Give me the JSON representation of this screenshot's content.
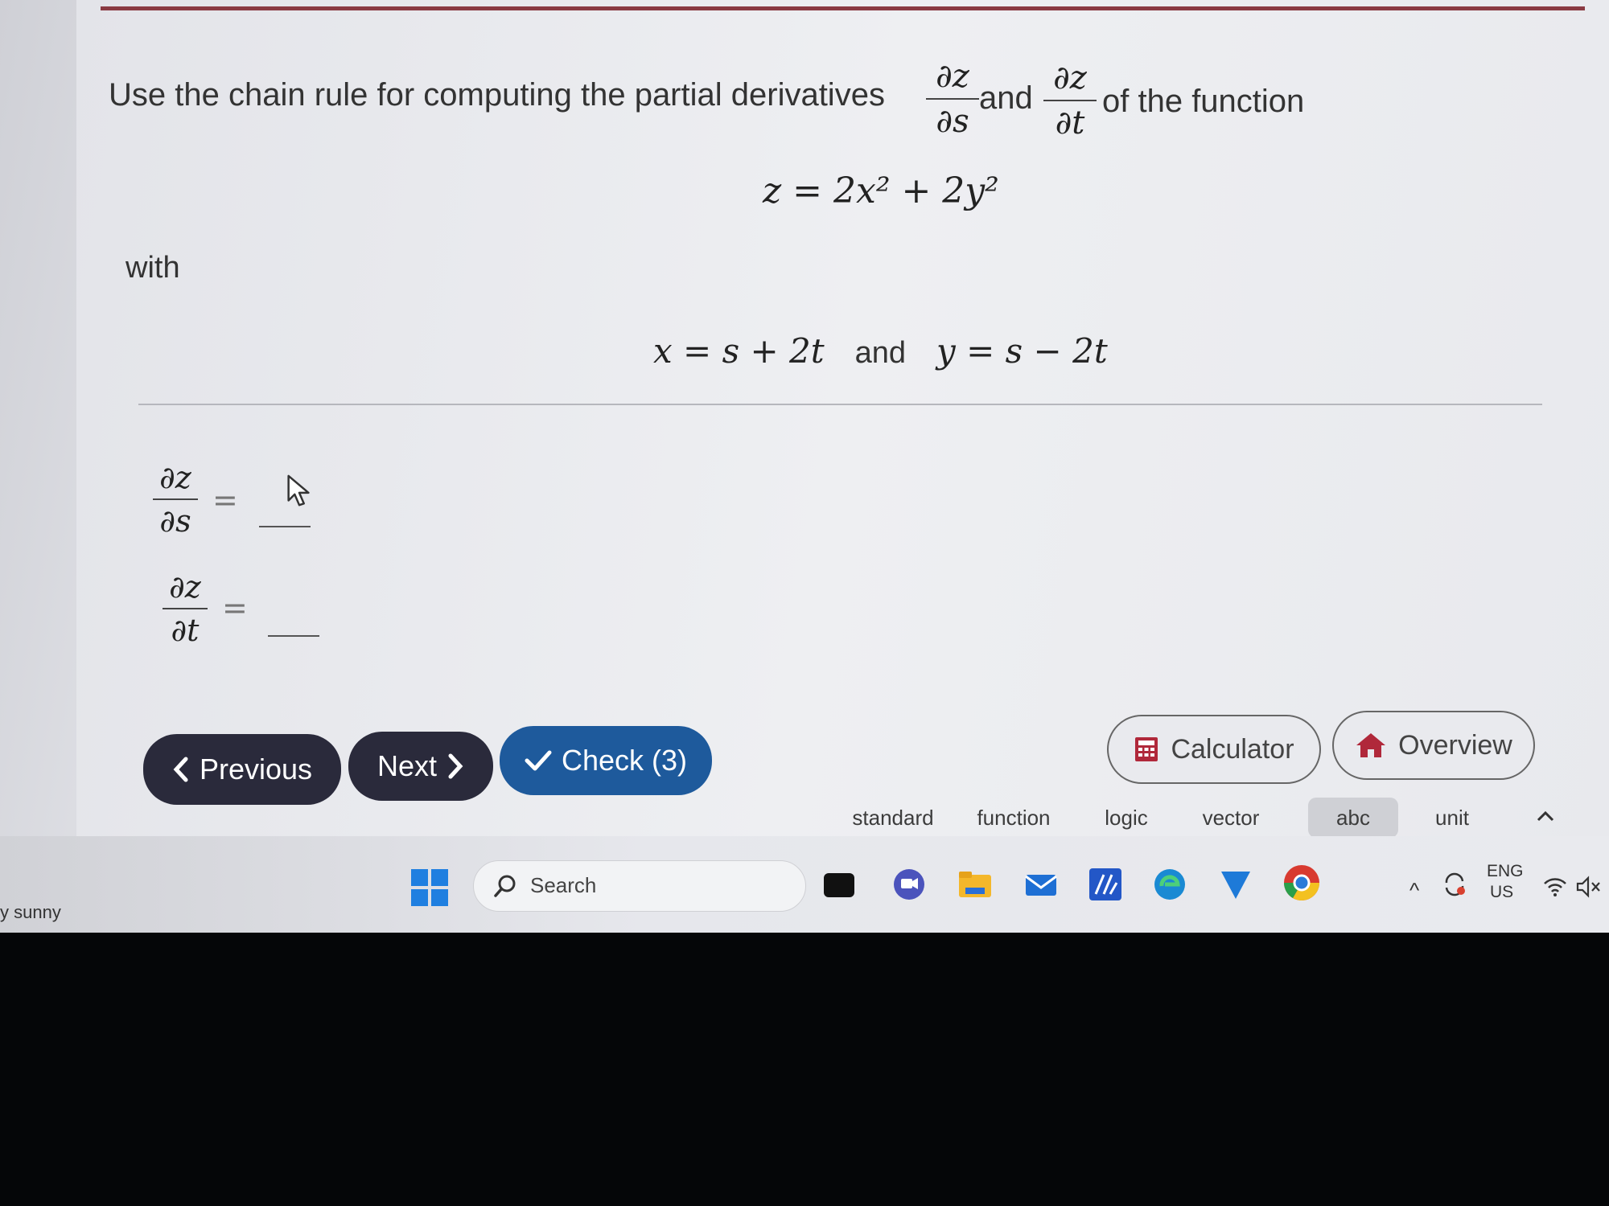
{
  "question": {
    "text_before": "Use the chain rule for computing the partial derivatives",
    "frac1": {
      "num": "∂z",
      "den": "∂s"
    },
    "and_word": "and",
    "frac2": {
      "num": "∂z",
      "den": "∂t"
    },
    "text_after": "of the function",
    "function_equation": "z = 2x² + 2y²",
    "with_label": "with",
    "substitution": {
      "x_eq": "x = s + 2t",
      "and_word": "and",
      "y_eq": "y = s − 2t"
    }
  },
  "answers": [
    {
      "num": "∂z",
      "den": "∂s",
      "equals": "=",
      "value": ""
    },
    {
      "num": "∂z",
      "den": "∂t",
      "equals": "=",
      "value": ""
    }
  ],
  "buttons": {
    "previous": "Previous",
    "next": "Next",
    "check": "Check (3)",
    "calculator": "Calculator",
    "overview": "Overview"
  },
  "keyboard_tabs": [
    "standard",
    "function",
    "logic",
    "vector",
    "abc",
    "unit"
  ],
  "taskbar": {
    "search_placeholder": "Search",
    "lang_line1": "ENG",
    "lang_line2": "US",
    "weather": "y sunny"
  },
  "colors": {
    "accent_bar": "#8a3a42",
    "nav_button": "#2a2a3b",
    "check_button": "#1e5a9c"
  }
}
